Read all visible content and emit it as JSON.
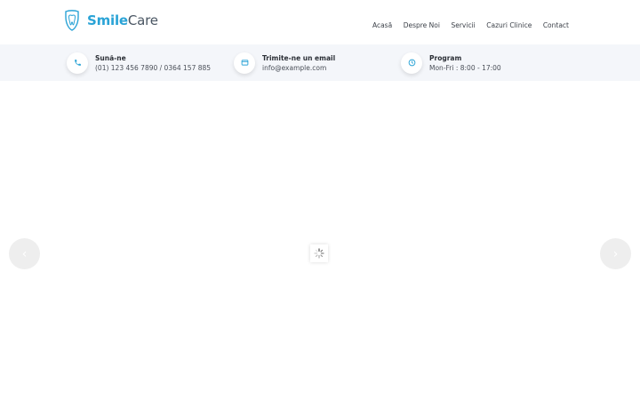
{
  "brand": {
    "name_part1": "Smile",
    "name_part2": "Care",
    "logo_icon": "tooth-icon",
    "primary_color": "#2aa3d6"
  },
  "nav": {
    "items": [
      {
        "label": "Acasă"
      },
      {
        "label": "Despre Noi"
      },
      {
        "label": "Servicii"
      },
      {
        "label": "Cazuri Clinice"
      },
      {
        "label": "Contact"
      }
    ]
  },
  "infobar": {
    "phone": {
      "icon": "phone-icon",
      "title": "Sună-ne",
      "value": "(01) 123 456 7890 / 0364 157 885"
    },
    "email": {
      "icon": "email-icon",
      "title": "Trimite-ne un email",
      "value": "info@example.com"
    },
    "schedule": {
      "icon": "clock-icon",
      "title": "Program",
      "value": "Mon-Fri : 8:00 - 17:00"
    }
  },
  "slider": {
    "prev_icon": "chevron-left-icon",
    "next_icon": "chevron-right-icon",
    "prev_glyph": "‹",
    "next_glyph": "›",
    "loader_icon": "loading-spinner-icon"
  }
}
